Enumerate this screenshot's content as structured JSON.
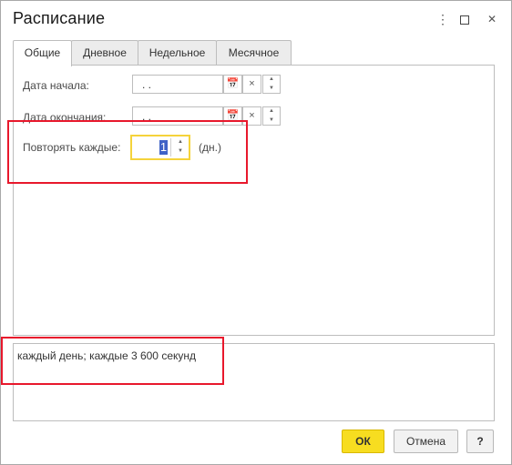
{
  "window": {
    "title": "Расписание",
    "more_icon": "⋮",
    "close_icon": "✕"
  },
  "tabs": [
    {
      "label": "Общие",
      "active": true
    },
    {
      "label": "Дневное",
      "active": false
    },
    {
      "label": "Недельное",
      "active": false
    },
    {
      "label": "Месячное",
      "active": false
    }
  ],
  "general": {
    "start_date": {
      "label": "Дата начала:",
      "value": ".  ."
    },
    "end_date": {
      "label": "Дата окончания:",
      "value": ".  ."
    },
    "repeat": {
      "label": "Повторять каждые:",
      "value": "1",
      "units": "(дн.)"
    }
  },
  "summary": {
    "text": "каждый день; каждые 3 600 секунд"
  },
  "buttons": {
    "ok": "ОК",
    "cancel": "Отмена",
    "help": "?"
  },
  "icons": {
    "calendar": "📅",
    "clear": "×",
    "spin_up": "▲",
    "spin_down": "▼"
  },
  "colors": {
    "highlight": "#e8182c",
    "focus": "#f5d33b",
    "ok_button": "#f7dd20",
    "selection": "#3f62c6"
  }
}
